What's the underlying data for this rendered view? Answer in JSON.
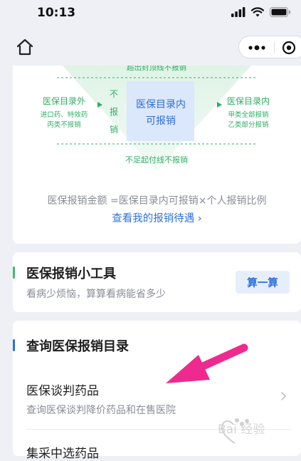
{
  "status_bar": {
    "time": "10:13"
  },
  "diagram": {
    "top_label": "超出封顶线不报销",
    "outside": {
      "title": "医保目录外",
      "line1": "进口药、特效药",
      "line2": "丙类不报销"
    },
    "not_reimburse": [
      "不",
      "报",
      "销"
    ],
    "inside_center": [
      "医保目录内",
      "可报销"
    ],
    "inside_right": {
      "title": "医保目录内",
      "line1": "甲类全部报销",
      "line2": "乙类部分报销"
    },
    "bottom_label": "不足起付线不报销"
  },
  "formula": "医保报销金额 =医保目录内可报销×个人报销比例",
  "view_link": "查看我的报销待遇 ›",
  "tools": {
    "title": "医保报销小工具",
    "subtitle": "看病少烦恼，算算看病能省多少",
    "button": "算一算",
    "accent": "#3cbf6a"
  },
  "catalog": {
    "title": "查询医保报销目录",
    "accent": "#2e72d8",
    "items": [
      {
        "title": "医保谈判药品",
        "subtitle": "查询医保谈判降价药品和在售医院"
      },
      {
        "title": "集采中选药品"
      }
    ]
  },
  "annotation": {
    "arrow_color": "#ee2a8f"
  },
  "watermark": {
    "text": "Bai 经验"
  }
}
